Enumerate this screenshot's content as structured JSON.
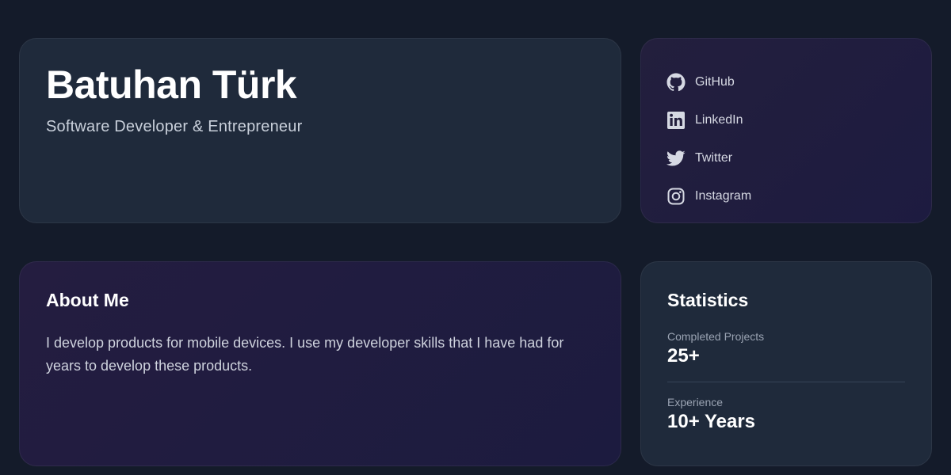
{
  "hero": {
    "name": "Batuhan Türk",
    "subtitle": "Software Developer & Entrepreneur"
  },
  "social": {
    "items": [
      {
        "label": "GitHub",
        "icon": "github-icon"
      },
      {
        "label": "LinkedIn",
        "icon": "linkedin-icon"
      },
      {
        "label": "Twitter",
        "icon": "twitter-icon"
      },
      {
        "label": "Instagram",
        "icon": "instagram-icon"
      }
    ]
  },
  "about": {
    "title": "About Me",
    "text": "I develop products for mobile devices. I use my developer skills that I have had for years to develop these products."
  },
  "stats": {
    "title": "Statistics",
    "items": [
      {
        "label": "Completed Projects",
        "value": "25+"
      },
      {
        "label": "Experience",
        "value": "10+ Years"
      }
    ]
  },
  "colors": {
    "background": "#141b2a",
    "card": "#1f2a3b",
    "card_purple": "#211d3f",
    "text_primary": "#ffffff",
    "text_muted": "#9aa3b2"
  }
}
